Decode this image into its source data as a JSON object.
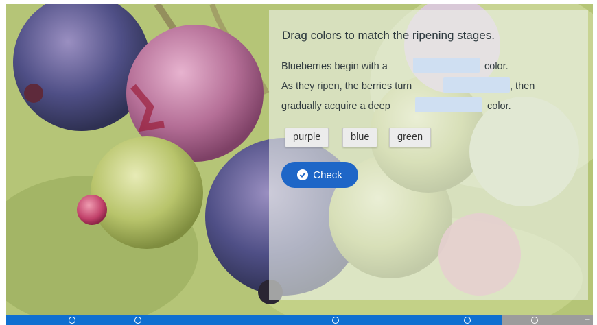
{
  "question": {
    "title": "Drag colors to match the ripening stages.",
    "line1": {
      "before": "Blueberries begin with a",
      "after": "color."
    },
    "line2": {
      "before": "As they ripen, the berries turn",
      "after": ", then"
    },
    "line3": {
      "before": "gradually acquire a deep",
      "after": "color."
    }
  },
  "options": [
    "purple",
    "blue",
    "green"
  ],
  "check_button": {
    "label": "Check",
    "icon": "check-circle-icon"
  },
  "progress": {
    "segments": 8,
    "active_segments": 7,
    "icons": [
      "circle-icon",
      "expand-icon"
    ]
  },
  "colors": {
    "accent": "#1e66c7",
    "bar": "#0f6fd0",
    "blank": "#cfdff2"
  }
}
